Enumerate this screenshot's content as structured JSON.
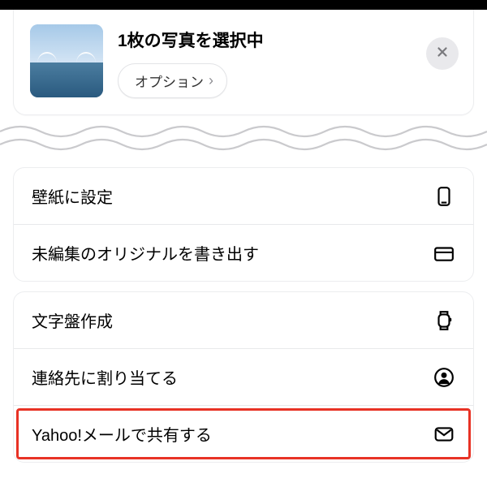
{
  "header": {
    "title": "1枚の写真を選択中",
    "options_label": "オプション"
  },
  "sections": [
    {
      "rows": [
        {
          "label": "壁紙に設定",
          "icon": "phone"
        },
        {
          "label": "未編集のオリジナルを書き出す",
          "icon": "folder"
        }
      ]
    },
    {
      "rows": [
        {
          "label": "文字盤作成",
          "icon": "watch"
        },
        {
          "label": "連絡先に割り当てる",
          "icon": "contact"
        },
        {
          "label": "Yahoo!メールで共有する",
          "icon": "mail",
          "highlight": true
        }
      ]
    }
  ]
}
